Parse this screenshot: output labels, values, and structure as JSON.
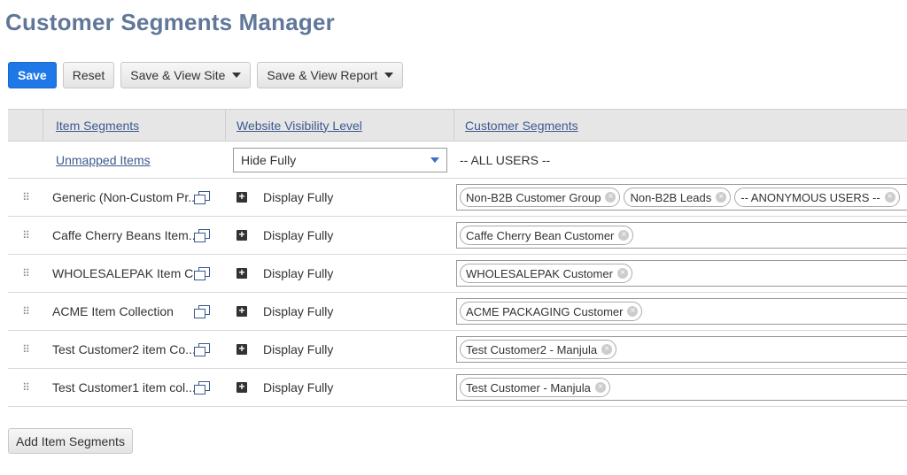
{
  "page": {
    "title": "Customer Segments Manager"
  },
  "toolbar": {
    "save": "Save",
    "reset": "Reset",
    "save_view_site": "Save & View Site",
    "save_view_report": "Save & View Report"
  },
  "table": {
    "headers": [
      "Item Segments",
      "Website Visibility Level",
      "Customer Segments"
    ],
    "unmapped": {
      "label": "Unmapped Items",
      "visibility": "Hide Fully",
      "customers": "-- ALL USERS --"
    },
    "rows": [
      {
        "name": "Generic (Non-Custom Pr...",
        "visibility": "Display Fully",
        "tags": [
          "Non-B2B Customer Group",
          "Non-B2B Leads",
          "-- ANONYMOUS USERS --"
        ]
      },
      {
        "name": "Caffe Cherry Beans Item...",
        "visibility": "Display Fully",
        "tags": [
          "Caffe Cherry Bean Customer"
        ]
      },
      {
        "name": "WHOLESALEPAK Item C...",
        "visibility": "Display Fully",
        "tags": [
          "WHOLESALEPAK Customer"
        ]
      },
      {
        "name": "ACME Item Collection",
        "visibility": "Display Fully",
        "tags": [
          "ACME PACKAGING Customer"
        ]
      },
      {
        "name": "Test Customer2 item Co...",
        "visibility": "Display Fully",
        "tags": [
          "Test Customer2 - Manjula"
        ]
      },
      {
        "name": "Test Customer1 item col...",
        "visibility": "Display Fully",
        "tags": [
          "Test Customer - Manjula"
        ]
      }
    ]
  },
  "footer": {
    "add_button": "Add Item Segments"
  },
  "colors": {
    "primary": "#1f78e8",
    "title": "#607799",
    "link": "#3c5a8e"
  },
  "icons": {
    "drag": "drag-handle-icon",
    "copy": "copy-icon",
    "expand": "expand-plus-icon",
    "remove": "remove-tag-icon",
    "dropdown": "chevron-down-icon"
  }
}
